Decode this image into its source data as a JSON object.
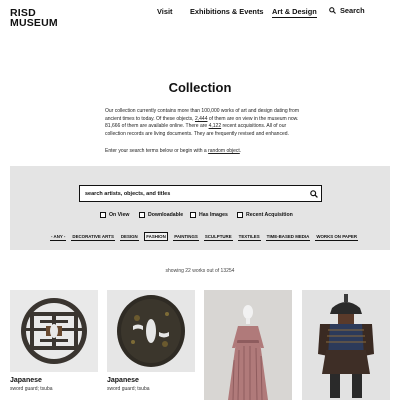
{
  "header": {
    "logo_line1": "RISD",
    "logo_line2": "MUSEUM",
    "nav": [
      {
        "label": "Visit"
      },
      {
        "label": "Exhibitions & Events"
      },
      {
        "label": "Art & Design",
        "active": true
      }
    ],
    "search_label": "Search"
  },
  "page_title": "Collection",
  "intro": {
    "text_a": "Our collection currently contains more than 100,000 works of art and design dating from ancient times to today. Of these objects, ",
    "link_on_view": "2,444",
    "text_b": " of them are on view in the museum now. 81,666 of them are available online. There are ",
    "link_recent": "4,122",
    "text_c": " recent acquisitions. All of our collection records are living documents. They are frequently revised and enhanced.",
    "enter_text": "Enter your search terms below or begin with a ",
    "random_link": "random object",
    "enter_end": "."
  },
  "search": {
    "placeholder": "search artists, objects, and titles"
  },
  "filters": [
    "On View",
    "Downloadable",
    "Has Images",
    "Recent Acquisition"
  ],
  "categories": [
    {
      "label": "- ANY -"
    },
    {
      "label": "DECORATIVE ARTS"
    },
    {
      "label": "DESIGN"
    },
    {
      "label": "FASHION",
      "selected": true
    },
    {
      "label": "PAINTINGS"
    },
    {
      "label": "SCULPTURE"
    },
    {
      "label": "TEXTILES"
    },
    {
      "label": "TIME-BASED MEDIA"
    },
    {
      "label": "WORKS ON PAPER"
    }
  ],
  "showing_text": "showing 22 works out of 13254",
  "results": [
    {
      "title": "Japanese",
      "subtitle": "sword guard; tsuba"
    },
    {
      "title": "Japanese",
      "subtitle": "sword guard; tsuba"
    },
    {
      "title": "",
      "subtitle": ""
    },
    {
      "title": "",
      "subtitle": ""
    }
  ],
  "colors": {
    "panel_bg": "#e4e4e4",
    "text": "#111111"
  }
}
